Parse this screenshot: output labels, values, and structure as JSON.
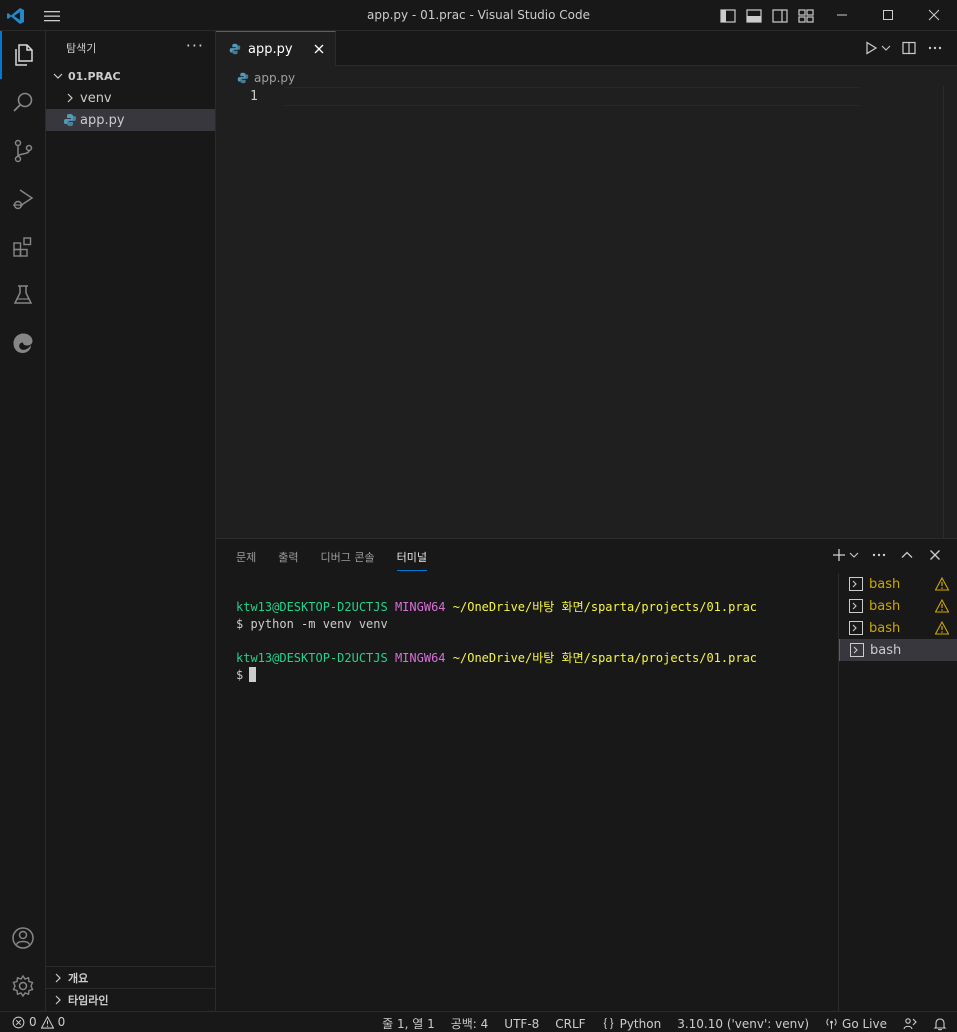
{
  "window": {
    "title": "app.py - 01.prac - Visual Studio Code"
  },
  "sidebar": {
    "title": "탐색기",
    "more": "···",
    "root_folder": "01.PRAC",
    "items": [
      {
        "label": "venv",
        "type": "folder"
      },
      {
        "label": "app.py",
        "type": "python-file"
      }
    ],
    "bottom_sections": [
      "개요",
      "타임라인"
    ]
  },
  "editor": {
    "tab_label": "app.py",
    "breadcrumb": "app.py",
    "line_number": "1"
  },
  "panel": {
    "tabs": [
      "문제",
      "출력",
      "디버그 콘솔",
      "터미널"
    ],
    "active_tab": "터미널",
    "terminal_lines": [
      {
        "user": "ktw13@DESKTOP-D2UCTJS",
        "host": "MINGW64",
        "path": "~/OneDrive/바탕 화면/sparta/projects/01.prac"
      },
      {
        "prompt": "$ python -m venv venv"
      },
      {
        "blank": ""
      },
      {
        "user": "ktw13@DESKTOP-D2UCTJS",
        "host": "MINGW64",
        "path": "~/OneDrive/바탕 화면/sparta/projects/01.prac"
      },
      {
        "prompt": "$"
      }
    ],
    "terminals": [
      {
        "label": "bash",
        "warning": true
      },
      {
        "label": "bash",
        "warning": true
      },
      {
        "label": "bash",
        "warning": true
      },
      {
        "label": "bash",
        "warning": false
      }
    ]
  },
  "statusbar": {
    "errors": "0",
    "warnings": "0",
    "cursor_position": "줄 1, 열 1",
    "spaces": "공백: 4",
    "encoding": "UTF-8",
    "eol": "CRLF",
    "language": "Python",
    "interpreter": "3.10.10 ('venv': venv)",
    "go_live": "Go Live"
  },
  "colors": {
    "accent": "#0078d4",
    "terminal_user": "#23d18b",
    "terminal_host": "#d670d6",
    "terminal_path": "#f5f543",
    "terminal_warning": "#cca700"
  }
}
